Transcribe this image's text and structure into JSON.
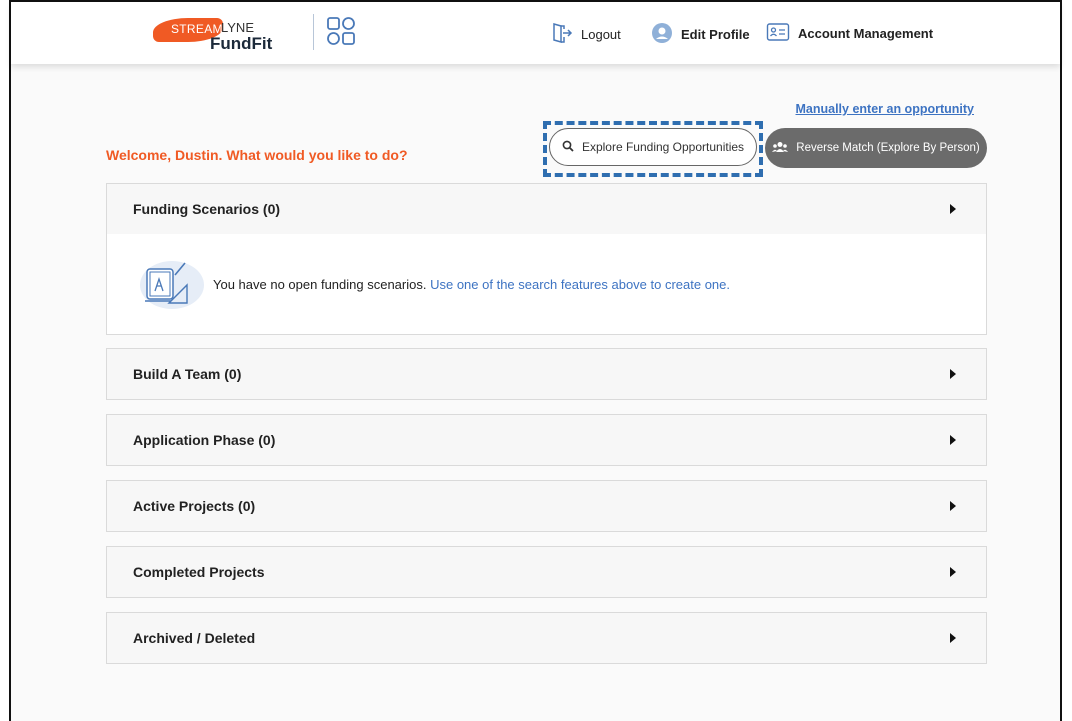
{
  "header": {
    "brand": {
      "stream": "STREAM",
      "lyne": "LYNE",
      "product": "FundFit"
    },
    "nav": [
      {
        "label": "Logout",
        "icon": "logout-icon"
      },
      {
        "label": "Edit Profile",
        "icon": "user-avatar-icon"
      },
      {
        "label": "Account Management",
        "icon": "id-card-icon"
      }
    ]
  },
  "main": {
    "manual_link": "Manually enter an opportunity",
    "welcome": "Welcome, Dustin. What would you like to do?",
    "explore_button": "Explore Funding Opportunities",
    "reverse_button": "Reverse Match (Explore By Person)",
    "sections": [
      {
        "title": "Funding Scenarios (0)"
      },
      {
        "title": "Build A Team (0)"
      },
      {
        "title": "Application Phase (0)"
      },
      {
        "title": "Active Projects (0)"
      },
      {
        "title": "Completed Projects"
      },
      {
        "title": "Archived / Deleted"
      }
    ],
    "empty_state": {
      "text": "You have no open funding scenarios.",
      "link": "Use one of the search features above to create one."
    }
  },
  "colors": {
    "brand_orange": "#f05a24",
    "link_blue": "#3d73c2",
    "highlight_dashed": "#2f6eb0",
    "reverse_button_bg": "#6b6b6b"
  }
}
